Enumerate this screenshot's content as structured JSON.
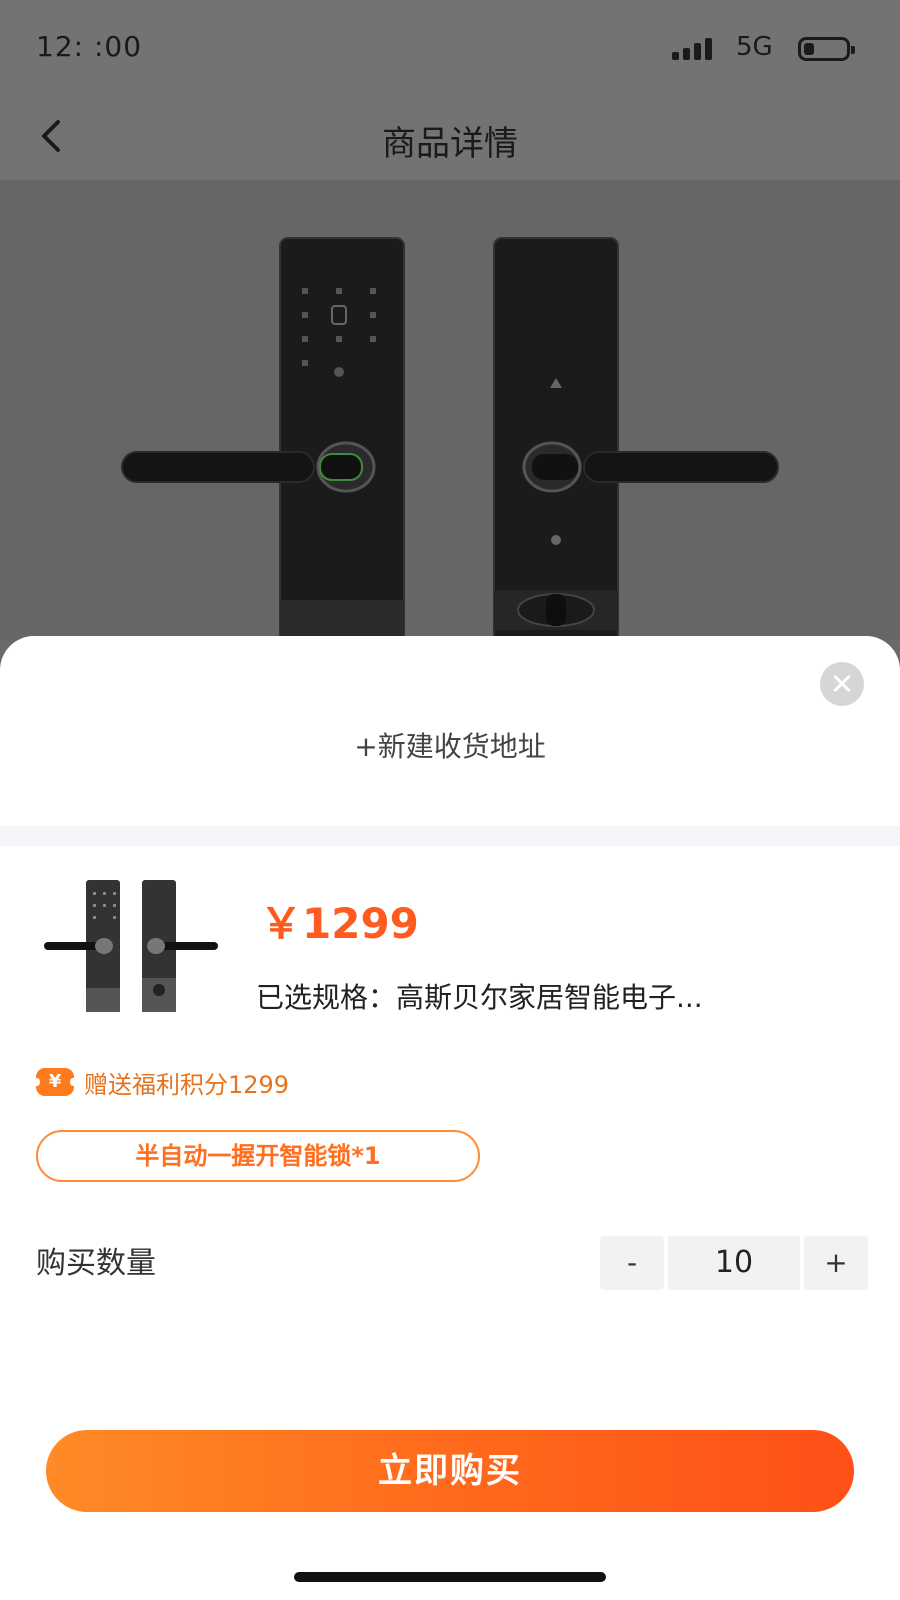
{
  "status_bar": {
    "time": "12:  :00",
    "network": "5G",
    "icons": [
      "signal-icon",
      "battery-icon"
    ]
  },
  "nav": {
    "title": "商品详情",
    "back_icon": "chevron-left-icon"
  },
  "sheet": {
    "address_label": "+新建收货地址",
    "close_icon": "close-circle-icon",
    "product": {
      "price": "￥1299",
      "spec": "已选规格：高斯贝尔家居智能电子..."
    },
    "points": {
      "icon_glyph": "¥",
      "text": "赠送福利积分1299"
    },
    "gift_tag": "半自动一握开智能锁*1",
    "quantity": {
      "label": "购买数量",
      "minus": "-",
      "value": "10",
      "plus": "+"
    },
    "buy_button": "立即购买"
  },
  "colors": {
    "accent": "#ff5a1f",
    "gradient_start": "#ff8a26",
    "gradient_end": "#ff4f17",
    "overlay": "#6a6a6a"
  }
}
